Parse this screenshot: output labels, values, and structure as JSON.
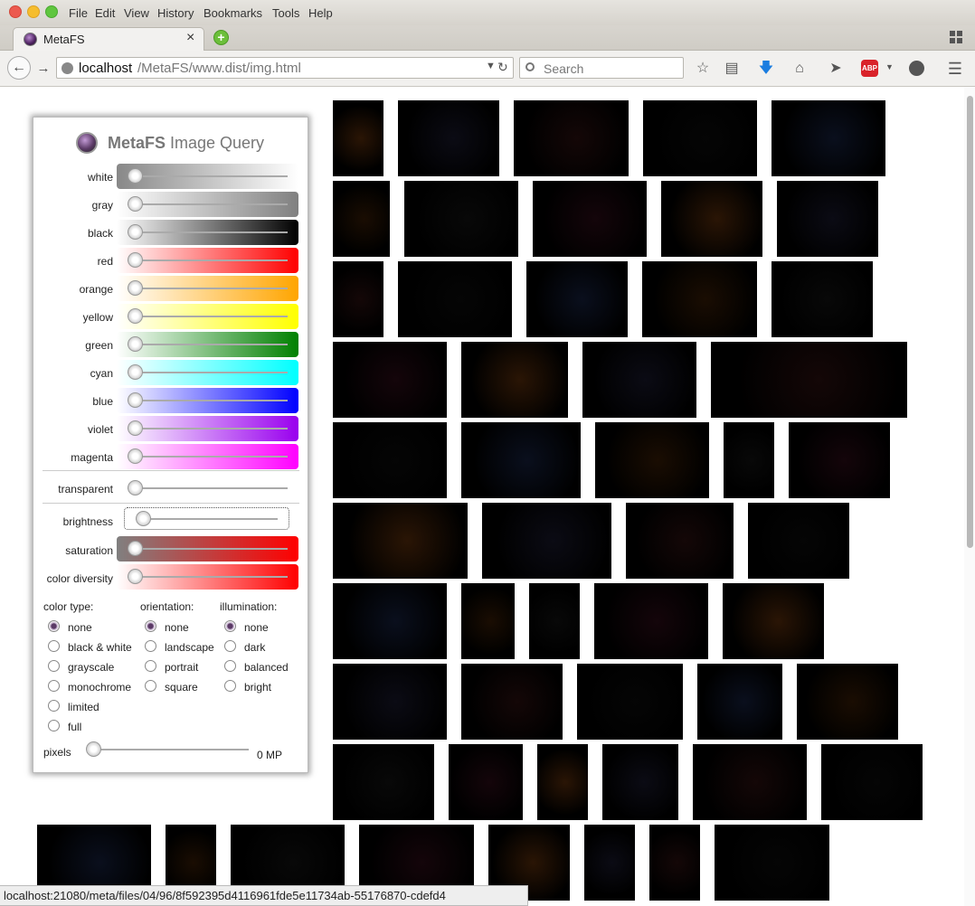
{
  "menubar": {
    "items": [
      "File",
      "Edit",
      "View",
      "History",
      "Bookmarks",
      "Tools",
      "Help"
    ]
  },
  "tab": {
    "title": "MetaFS",
    "close": "×",
    "new_tab": "+"
  },
  "toolbar": {
    "url_host": "localhost",
    "url_path": "/MetaFS/www.dist/img.html",
    "search_placeholder": "Search",
    "icons": [
      "back-icon",
      "forward-icon",
      "site-info-icon",
      "dropdown-icon",
      "reload-icon",
      "search-icon",
      "bookmark-star-icon",
      "reading-list-icon",
      "downloads-icon",
      "home-icon",
      "share-icon",
      "adblock-icon",
      "chat-icon",
      "menu-icon"
    ],
    "abp_label": "ABP"
  },
  "panel": {
    "title_bold": "MetaFS",
    "title_light": "Image Query",
    "color_sliders": [
      {
        "label": "white",
        "gradient": [
          "#888888",
          "#ffffff"
        ]
      },
      {
        "label": "gray",
        "gradient": [
          "#ffffff",
          "#808080"
        ]
      },
      {
        "label": "black",
        "gradient": [
          "#ffffff",
          "#000000"
        ]
      },
      {
        "label": "red",
        "gradient": [
          "#ffffff",
          "#ff0000"
        ]
      },
      {
        "label": "orange",
        "gradient": [
          "#ffffff",
          "#ffa500"
        ]
      },
      {
        "label": "yellow",
        "gradient": [
          "#ffffff",
          "#ffff00"
        ]
      },
      {
        "label": "green",
        "gradient": [
          "#ffffff",
          "#008000"
        ]
      },
      {
        "label": "cyan",
        "gradient": [
          "#ffffff",
          "#00ffff"
        ]
      },
      {
        "label": "blue",
        "gradient": [
          "#ffffff",
          "#0000ff"
        ]
      },
      {
        "label": "violet",
        "gradient": [
          "#ffffff",
          "#9900ee"
        ]
      },
      {
        "label": "magenta",
        "gradient": [
          "#ffffff",
          "#ff00ff"
        ]
      }
    ],
    "transparent_label": "transparent",
    "brightness_label": "brightness",
    "saturation_label": "saturation",
    "saturation_gradient": [
      "#808080",
      "#ff0000"
    ],
    "diversity_label": "color diversity",
    "diversity_gradient": [
      "#ffffff",
      "#ff0000"
    ],
    "groups": [
      {
        "title": "color type:",
        "options": [
          "none",
          "black & white",
          "grayscale",
          "monochrome",
          "limited",
          "full"
        ],
        "selected": 0
      },
      {
        "title": "orientation:",
        "options": [
          "none",
          "landscape",
          "portrait",
          "square"
        ],
        "selected": 0
      },
      {
        "title": "illumination:",
        "options": [
          "none",
          "dark",
          "balanced",
          "bright"
        ],
        "selected": 0
      }
    ],
    "pixels_label": "pixels",
    "pixels_value": "0 MP"
  },
  "status": {
    "url": "localhost:21080/meta/files/04/96/8f592395d4116961fde5e11734ab-55176870-cdefd4"
  },
  "colors": {
    "accent": "#5b3a66",
    "thumb_bg": "#000000"
  }
}
